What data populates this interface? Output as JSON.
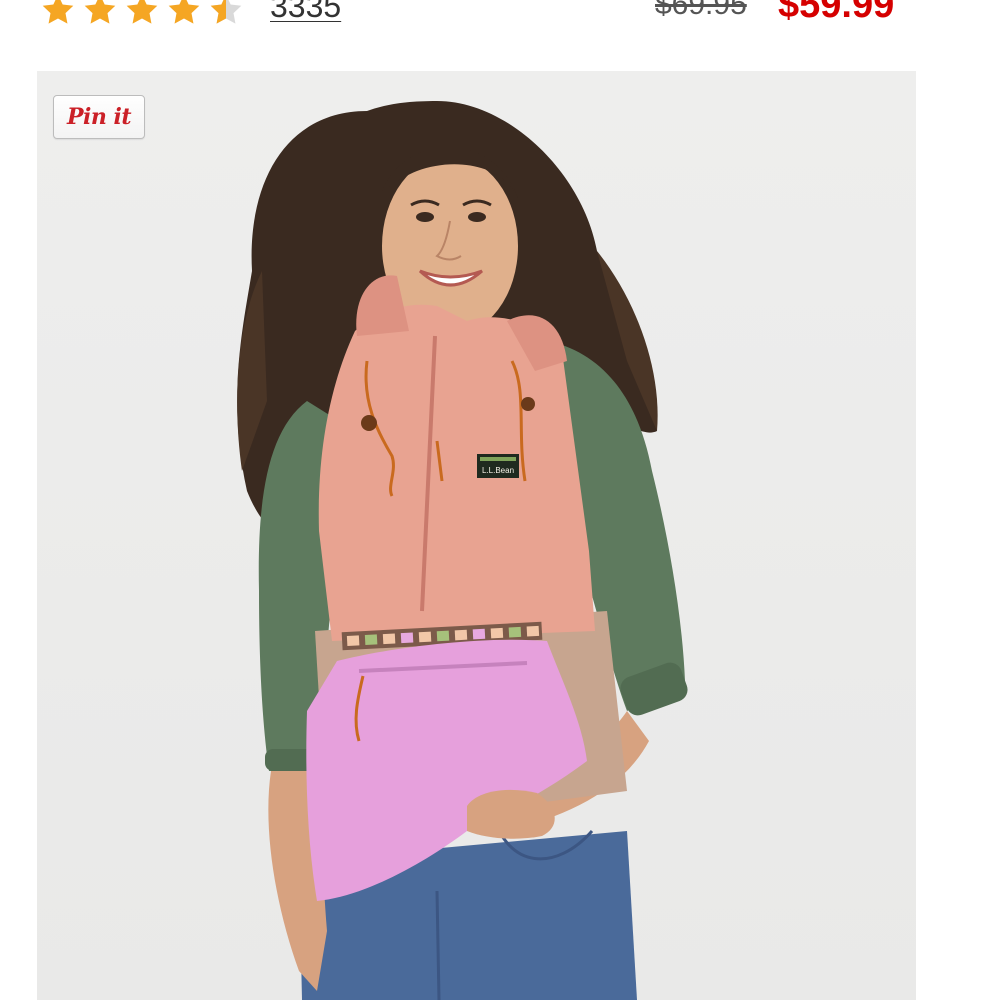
{
  "rating": {
    "stars_value": 4.5,
    "stars_max": 5,
    "star_color": "#f5a623",
    "review_count": "3335"
  },
  "price": {
    "original": "$69.95",
    "sale": "$59.99",
    "sale_color": "#d50000"
  },
  "product_image": {
    "pin_button_label": "Pin it",
    "brand_patch_text": "L.L.Bean",
    "jacket_colors": {
      "body": "#e8a391",
      "sleeves": "#5e7a5e",
      "pocket": "#e6a0dc",
      "lower_panel": "#c7a58f",
      "jeans": "#4a6a9a"
    }
  }
}
